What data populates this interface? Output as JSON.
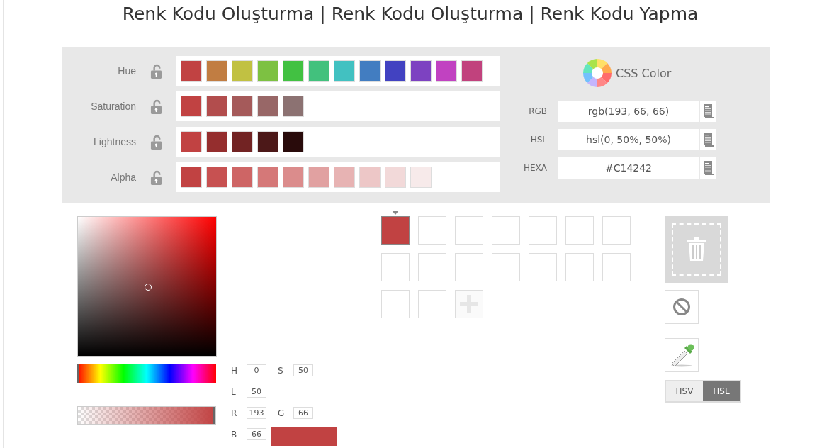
{
  "title": "Renk Kodu Oluşturma | Renk Kodu Oluşturma | Renk Kodu Yapma",
  "variation_rows": [
    {
      "label": "Hue",
      "swatches": [
        {
          "color": "#c14242"
        },
        {
          "color": "#c17d42"
        },
        {
          "color": "#c1c142"
        },
        {
          "color": "#7dc142"
        },
        {
          "color": "#42c142"
        },
        {
          "color": "#42c17d"
        },
        {
          "color": "#42c1c1"
        },
        {
          "color": "#427dc1"
        },
        {
          "color": "#4242c1"
        },
        {
          "color": "#7d42c1"
        },
        {
          "color": "#c142c1"
        },
        {
          "color": "#c1427d"
        }
      ]
    },
    {
      "label": "Saturation",
      "swatches": [
        {
          "color": "#c14242"
        },
        {
          "color": "#b24d4d"
        },
        {
          "color": "#a55a5a"
        },
        {
          "color": "#986767"
        },
        {
          "color": "#8c7272"
        }
      ]
    },
    {
      "label": "Lightness",
      "swatches": [
        {
          "color": "#c14242"
        },
        {
          "color": "#952e2e"
        },
        {
          "color": "#722323"
        },
        {
          "color": "#4c1818"
        },
        {
          "color": "#290b0b"
        }
      ]
    },
    {
      "label": "Alpha",
      "swatches": [
        {
          "color": "#c14242"
        },
        {
          "color": "#c75151"
        },
        {
          "color": "#ce6565"
        },
        {
          "color": "#d57878"
        },
        {
          "color": "#db8c8c"
        },
        {
          "color": "#e1a1a1"
        },
        {
          "color": "#e7b3b3"
        },
        {
          "color": "#edc7c7"
        },
        {
          "color": "#f2d9d9"
        },
        {
          "color": "#f7eaea"
        }
      ]
    }
  ],
  "css_color": {
    "title": "CSS Color",
    "fields": [
      {
        "label": "RGB",
        "value": "rgb(193, 66, 66)"
      },
      {
        "label": "HSL",
        "value": "hsl(0, 50%, 50%)"
      },
      {
        "label": "HEXA",
        "value": "#C14242"
      }
    ]
  },
  "hue_slider": {
    "level": 0
  },
  "alpha_slider": {
    "level": 1
  },
  "inputs": [
    {
      "label": "H",
      "value": "0"
    },
    {
      "label": "S",
      "value": "50"
    },
    {
      "label": "L",
      "value": "50"
    },
    {
      "label": "R",
      "value": "193"
    },
    {
      "label": "G",
      "value": "66"
    },
    {
      "label": "B",
      "value": "66"
    }
  ],
  "preview": {
    "color": "#c14242"
  },
  "palette": [
    {
      "color": "#c14242",
      "selected": true
    },
    {
      "selected": false
    },
    {
      "selected": false
    },
    {
      "selected": false
    },
    {
      "selected": false
    },
    {
      "selected": false
    },
    {
      "selected": false
    },
    {
      "selected": false
    },
    {
      "selected": false
    },
    {
      "selected": false
    },
    {
      "selected": false
    },
    {
      "selected": false
    },
    {
      "selected": false
    },
    {
      "selected": false
    },
    {
      "selected": false
    },
    {
      "selected": false
    }
  ],
  "modes": [
    {
      "label": "HSV",
      "selected": false
    },
    {
      "label": "HSL",
      "selected": true
    }
  ]
}
